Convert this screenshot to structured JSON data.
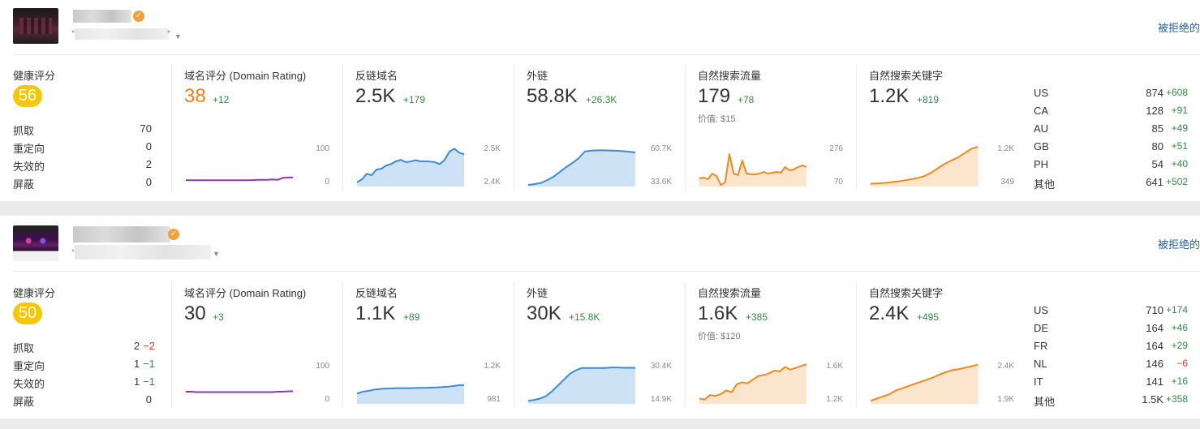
{
  "colors": {
    "green": "#2e8b3e",
    "red": "#d93c31",
    "blue_line": "#3a8bd8",
    "orange_line": "#f08a1c",
    "purple_line": "#8b3aa8",
    "badge": "#f7c700",
    "link": "#1f5fa8"
  },
  "cards": [
    {
      "reject_link": "被拒绝的",
      "health": {
        "label": "健康评分",
        "score": "56",
        "rows": [
          {
            "key": "抓取",
            "value": "70",
            "delta": ""
          },
          {
            "key": "重定向",
            "value": "0",
            "delta": ""
          },
          {
            "key": "失效的",
            "value": "2",
            "delta": ""
          },
          {
            "key": "屏蔽",
            "value": "0",
            "delta": ""
          }
        ]
      },
      "dr": {
        "label": "域名评分 (Domain Rating)",
        "value": "38",
        "delta": "+12",
        "axis_top": "100",
        "axis_bottom": "0",
        "chart_data": {
          "type": "line",
          "values": [
            12,
            12,
            12,
            12,
            12,
            12,
            12,
            12,
            12,
            12,
            12,
            12,
            12,
            12,
            13,
            13,
            13,
            14,
            13,
            18,
            19,
            19
          ],
          "ylim": [
            0,
            100
          ]
        }
      },
      "ref_domains": {
        "label": "反链域名",
        "value": "2.5K",
        "delta": "+179",
        "axis_top": "2.5K",
        "axis_bottom": "2.4K",
        "chart_data": {
          "type": "area",
          "values": [
            2400,
            2410,
            2430,
            2425,
            2445,
            2448,
            2460,
            2465,
            2475,
            2480,
            2472,
            2474,
            2479,
            2475,
            2475,
            2474,
            2472,
            2465,
            2480,
            2510,
            2520,
            2506,
            2500
          ],
          "ylim": [
            2390,
            2530
          ]
        }
      },
      "backlinks": {
        "label": "外链",
        "value": "58.8K",
        "delta": "+26.3K",
        "axis_top": "60.7K",
        "axis_bottom": "33.6K",
        "chart_data": {
          "type": "area",
          "values": [
            33600,
            34200,
            35000,
            37000,
            39500,
            43000,
            46500,
            49500,
            53000,
            58000,
            58600,
            58800,
            58800,
            58700,
            58500,
            58200,
            57800,
            57300
          ],
          "ylim": [
            33600,
            62000
          ]
        }
      },
      "traffic": {
        "label": "自然搜索流量",
        "value": "179",
        "delta": "+78",
        "sub": "价值: $15",
        "axis_top": "276",
        "axis_bottom": "70",
        "chart_data": {
          "type": "area",
          "values": [
            80,
            85,
            75,
            110,
            95,
            40,
            55,
            230,
            110,
            100,
            190,
            110,
            105,
            105,
            110,
            120,
            110,
            115,
            120,
            115,
            150,
            130,
            135,
            150,
            160,
            150
          ],
          "ylim": [
            40,
            280
          ]
        }
      },
      "keywords": {
        "label": "自然搜索关键字",
        "value": "1.2K",
        "delta": "+819",
        "axis_top": "1.2K",
        "axis_bottom": "349",
        "chart_data": {
          "type": "area",
          "values": [
            349,
            355,
            365,
            380,
            400,
            420,
            450,
            480,
            520,
            600,
            700,
            800,
            880,
            950,
            1050,
            1150,
            1200
          ],
          "ylim": [
            320,
            1220
          ]
        }
      },
      "countries": [
        {
          "code": "US",
          "count": "874",
          "delta": "+608"
        },
        {
          "code": "CA",
          "count": "128",
          "delta": "+91"
        },
        {
          "code": "AU",
          "count": "85",
          "delta": "+49"
        },
        {
          "code": "GB",
          "count": "80",
          "delta": "+51"
        },
        {
          "code": "PH",
          "count": "54",
          "delta": "+40"
        },
        {
          "code": "其他",
          "count": "641",
          "delta": "+502"
        }
      ]
    },
    {
      "reject_link": "被拒绝的",
      "health": {
        "label": "健康评分",
        "score": "50",
        "rows": [
          {
            "key": "抓取",
            "value": "2",
            "delta": "−2"
          },
          {
            "key": "重定向",
            "value": "1",
            "delta": "−1"
          },
          {
            "key": "失效的",
            "value": "1",
            "delta": "−1"
          },
          {
            "key": "屏蔽",
            "value": "0",
            "delta": ""
          }
        ]
      },
      "dr": {
        "label": "域名评分 (Domain Rating)",
        "value": "30",
        "delta": "+3",
        "axis_top": "100",
        "axis_bottom": "0",
        "chart_data": {
          "type": "line",
          "values": [
            27,
            27,
            26,
            26,
            26,
            26,
            26,
            26,
            26,
            26,
            26,
            26,
            26,
            26,
            26,
            26,
            26,
            26,
            27,
            27,
            28,
            28
          ],
          "ylim": [
            0,
            100
          ]
        }
      },
      "ref_domains": {
        "label": "反链域名",
        "value": "1.1K",
        "delta": "+89",
        "axis_top": "1.2K",
        "axis_bottom": "981",
        "chart_data": {
          "type": "area",
          "values": [
            1030,
            1040,
            1045,
            1052,
            1055,
            1058,
            1058,
            1060,
            1060,
            1060,
            1061,
            1062,
            1062,
            1063,
            1064,
            1066,
            1068,
            1072,
            1076,
            1078
          ],
          "ylim": [
            981,
            1200
          ]
        }
      },
      "backlinks": {
        "label": "外链",
        "value": "30K",
        "delta": "+15.8K",
        "axis_top": "30.4K",
        "axis_bottom": "14.9K",
        "chart_data": {
          "type": "area",
          "values": [
            14900,
            15300,
            15900,
            17000,
            19000,
            21500,
            24000,
            26500,
            28000,
            29000,
            29000,
            29000,
            29000,
            29000,
            29200,
            29200,
            29100,
            29100,
            29050
          ],
          "ylim": [
            14300,
            31000
          ]
        }
      },
      "traffic": {
        "label": "自然搜索流量",
        "value": "1.6K",
        "delta": "+385",
        "sub": "价值: $120",
        "axis_top": "1.6K",
        "axis_bottom": "1.2K",
        "chart_data": {
          "type": "area",
          "values": [
            1220,
            1210,
            1260,
            1250,
            1270,
            1310,
            1290,
            1380,
            1400,
            1390,
            1430,
            1470,
            1480,
            1500,
            1530,
            1520,
            1570,
            1540,
            1560,
            1580,
            1600
          ],
          "ylim": [
            1180,
            1610
          ]
        }
      },
      "keywords": {
        "label": "自然搜索关键字",
        "value": "2.4K",
        "delta": "+495",
        "axis_top": "2.4K",
        "axis_bottom": "1.9K",
        "chart_data": {
          "type": "area",
          "values": [
            1900,
            1930,
            1960,
            1990,
            2040,
            2070,
            2100,
            2130,
            2160,
            2190,
            2220,
            2260,
            2290,
            2320,
            2330,
            2350,
            2370,
            2390
          ],
          "ylim": [
            1880,
            2410
          ]
        }
      },
      "countries": [
        {
          "code": "US",
          "count": "710",
          "delta": "+174"
        },
        {
          "code": "DE",
          "count": "164",
          "delta": "+46"
        },
        {
          "code": "FR",
          "count": "164",
          "delta": "+29"
        },
        {
          "code": "NL",
          "count": "146",
          "delta": "−6"
        },
        {
          "code": "IT",
          "count": "141",
          "delta": "+16"
        },
        {
          "code": "其他",
          "count": "1.5K",
          "delta": "+358"
        }
      ]
    }
  ]
}
